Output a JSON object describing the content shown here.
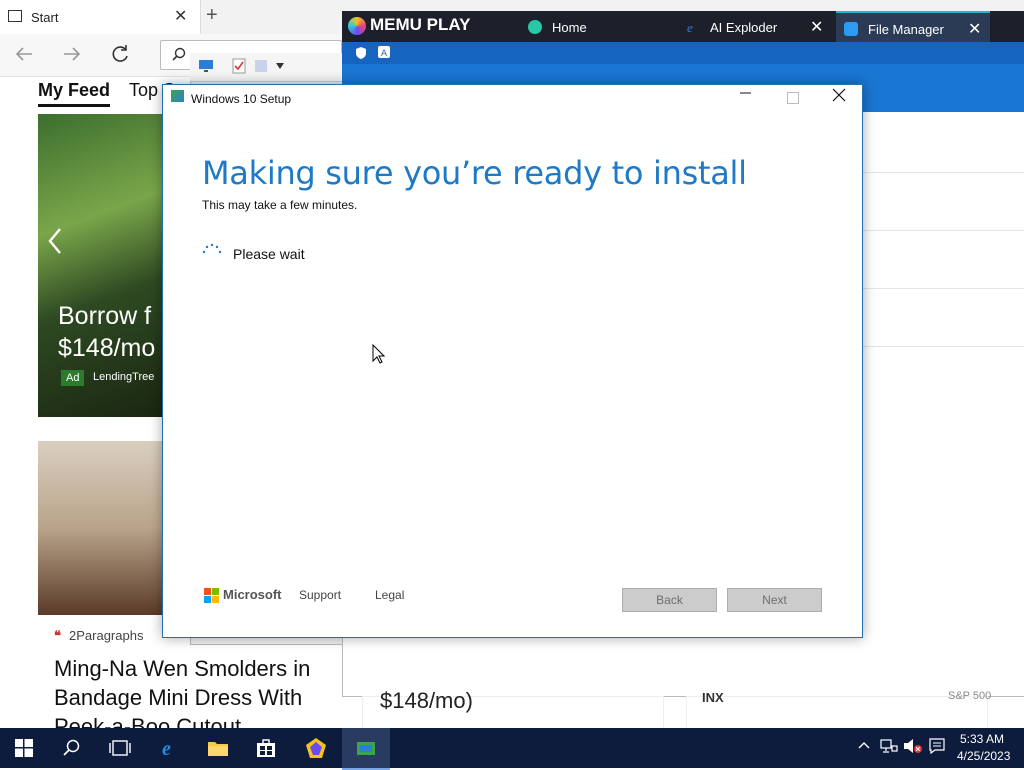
{
  "edge": {
    "tab_title": "Start",
    "close_glyph": "✕",
    "new_tab_glyph": "+",
    "feed_tab_active": "My Feed",
    "feed_tab_2": "Top S",
    "card1_title": "Borrow f\n$148/mo",
    "card1_ad": "Ad",
    "card1_source": "LendingTree",
    "card2_source": "2Paragraphs",
    "card2_title": "Ming-Na Wen Smolders in Bandage Mini Dress With Peek-a-Boo Cutout"
  },
  "memu": {
    "logo_text": "MEMU PLAY",
    "tabs": [
      {
        "label": "Home",
        "icon": "home-app-icon",
        "color": "#29c7a8"
      },
      {
        "label": "AI Exploder",
        "icon": "ie-icon",
        "color": "#3a7bd5"
      },
      {
        "label": "File Manager",
        "icon": "folder-icon",
        "color": "#2b9bf4"
      }
    ],
    "bottom_text": "$148/mo)",
    "inx_label": "INX",
    "sp_label": "S&P 500",
    "accent": "#1976d2"
  },
  "setup": {
    "window_title": "Windows 10 Setup",
    "heading": "Making sure you’re ready to install",
    "subtext": "This may take a few minutes.",
    "status": "Please wait",
    "brand": "Microsoft",
    "link_support": "Support",
    "link_legal": "Legal",
    "btn_back": "Back",
    "btn_next": "Next",
    "accent": "#1f7ac6"
  },
  "taskbar": {
    "time": "5:33 AM",
    "date": "4/25/2023"
  }
}
